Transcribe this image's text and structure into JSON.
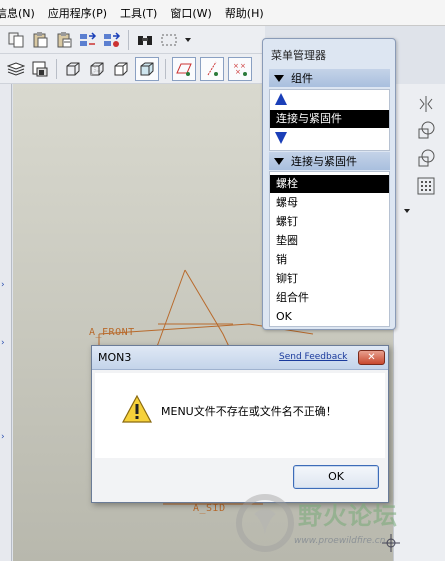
{
  "menubar": {
    "items": [
      "信息(N)",
      "应用程序(P)",
      "工具(T)",
      "窗口(W)",
      "帮助(H)"
    ]
  },
  "canvas": {
    "plane_front": "A_FRONT",
    "plane_side": "A_SID"
  },
  "menu_manager": {
    "title": "菜单管理器",
    "section1": "组件",
    "section1_selected": "连接与紧固件",
    "section2": "连接与紧固件",
    "items": [
      "螺栓",
      "螺母",
      "螺钉",
      "垫圈",
      "销",
      "铆钉",
      "组合件",
      "OK"
    ],
    "selected_item": "螺栓"
  },
  "dialog": {
    "title": "MON3",
    "feedback_link": "Send Feedback",
    "close_label": "✕",
    "message": "MENU文件不存在或文件名不正确！",
    "ok_label": "OK"
  },
  "watermark": {
    "title": "野火论坛",
    "url": "www.proewildfire.cn"
  },
  "colors": {
    "selection": "#000000",
    "accent_blue": "#1a3fb8",
    "plane_orange": "#b86a2c",
    "dialog_close_red": "#c8482e"
  }
}
